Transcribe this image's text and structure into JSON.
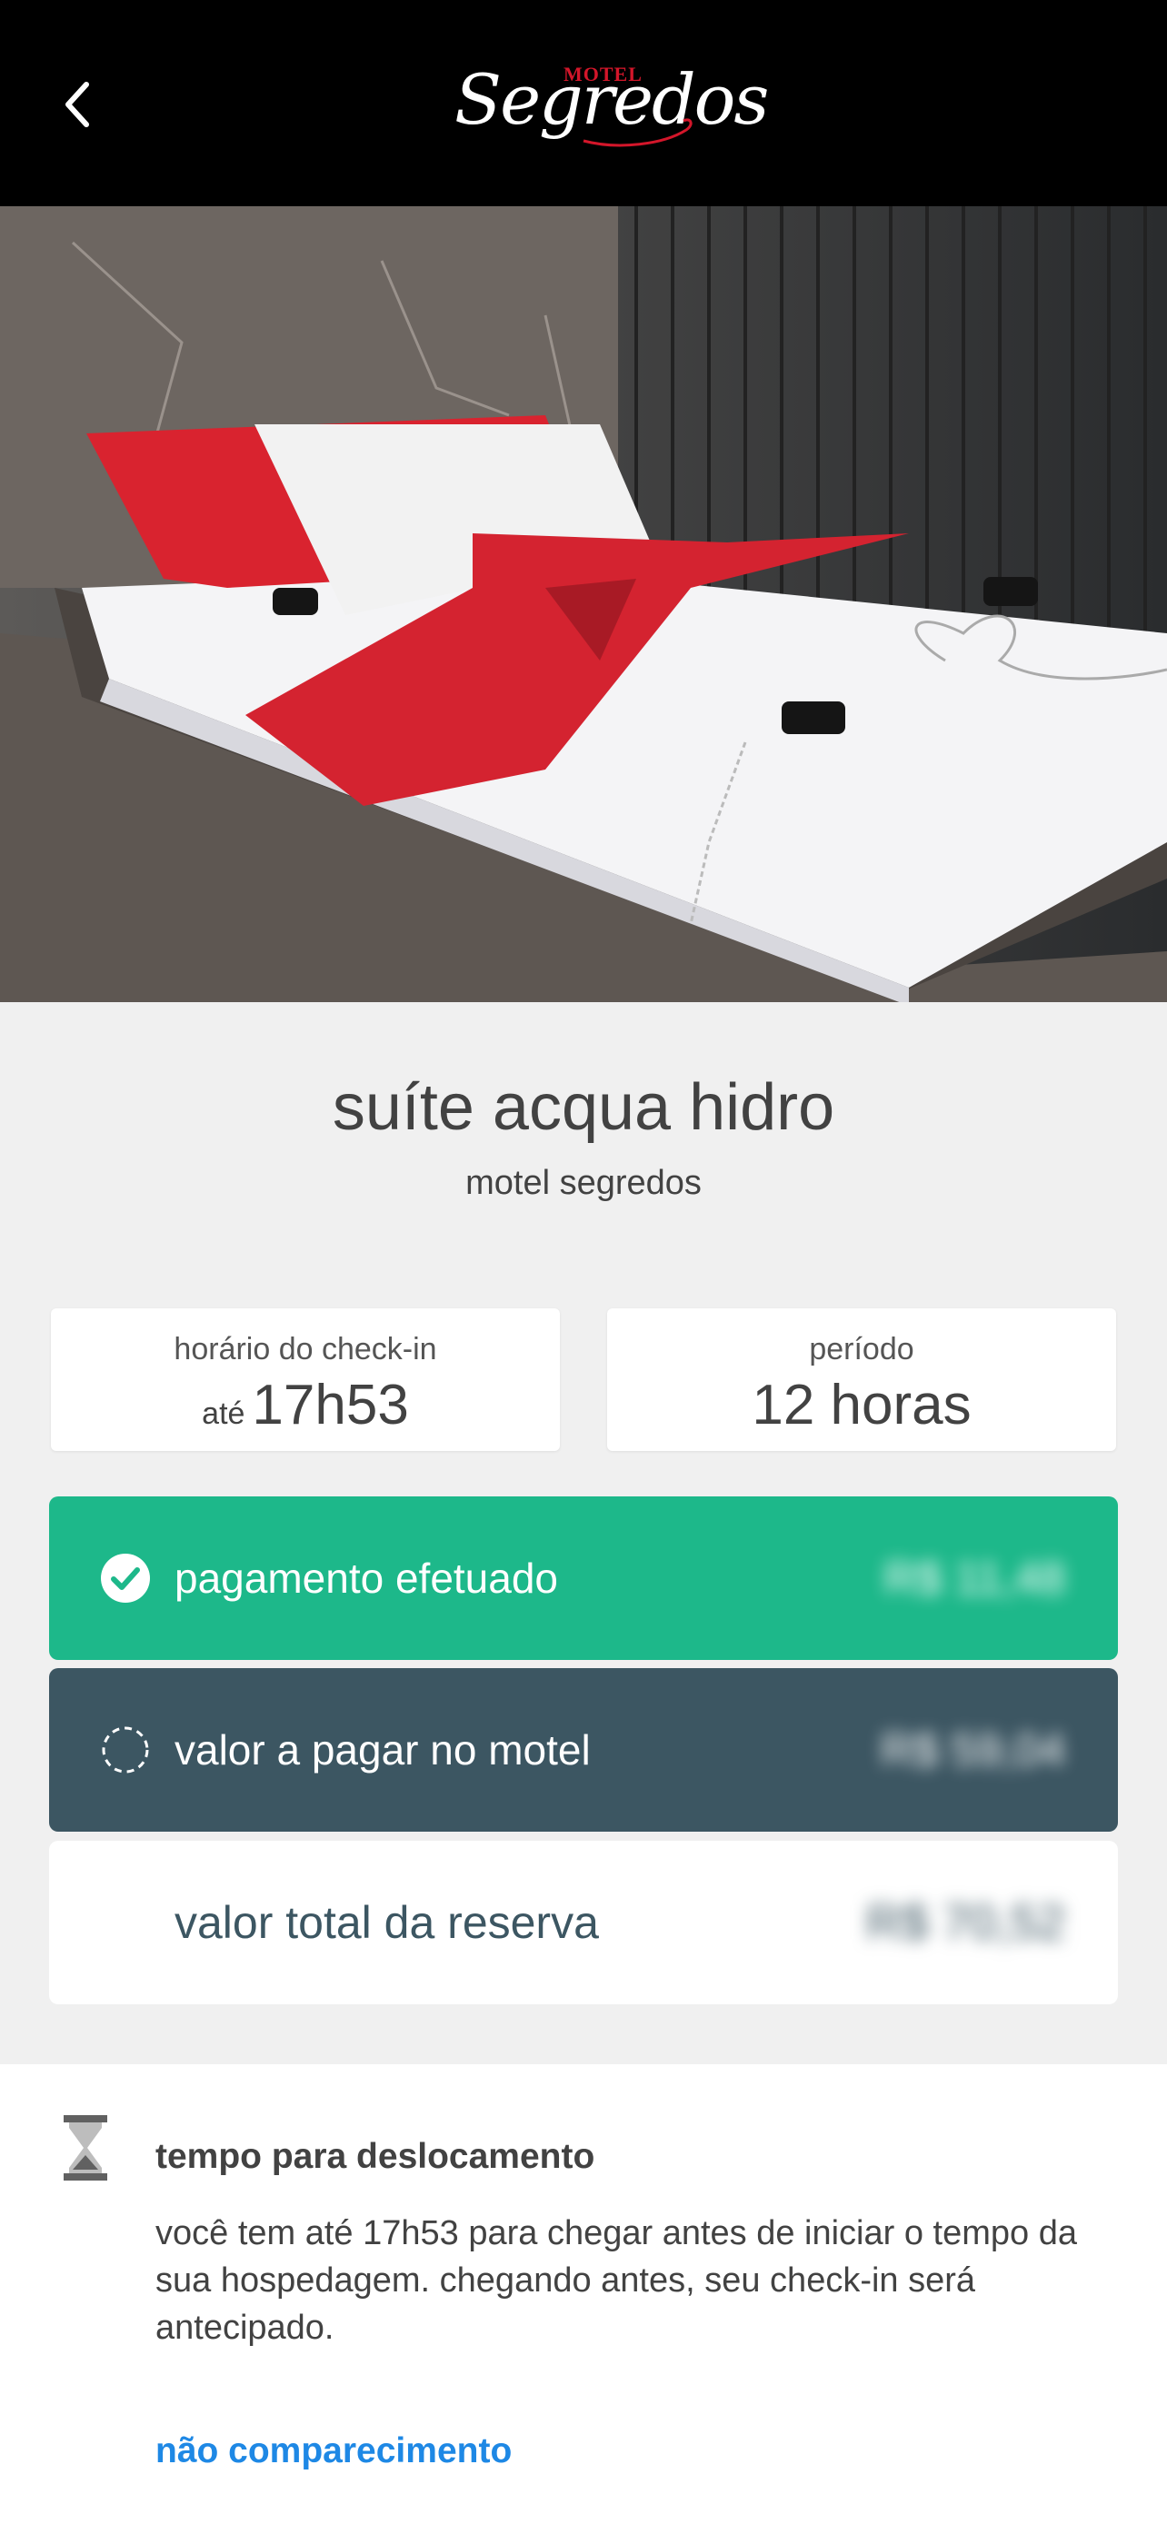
{
  "header": {
    "back_icon": "chevron-left-icon",
    "logo_small_text": "MOTEL",
    "logo_script_text": "Segredos"
  },
  "suite": {
    "title": "suíte acqua hidro",
    "motel": "motel segredos"
  },
  "checkin": {
    "label": "horário do check-in",
    "prefix": "até",
    "value": "17h53"
  },
  "period": {
    "label": "período",
    "value": "12 horas"
  },
  "payment": {
    "paid_label": "pagamento efetuado",
    "paid_amount": "R$ 11,48",
    "paid_icon": "check-circle-icon",
    "due_label": "valor a pagar no motel",
    "due_amount": "R$ 59,04",
    "due_icon": "dashed-circle-icon",
    "total_label": "valor total da reserva",
    "total_amount": "R$ 70,52"
  },
  "travel": {
    "icon": "hourglass-icon",
    "title": "tempo para deslocamento",
    "text": "você tem até 17h53 para chegar antes de iniciar o tempo da sua hospedagem. chegando antes, seu check-in será antecipado.",
    "no_show_link": "não comparecimento"
  },
  "colors": {
    "paid": "#1db88a",
    "due": "#3c5662",
    "link": "#1e88e5",
    "header": "#000000"
  }
}
